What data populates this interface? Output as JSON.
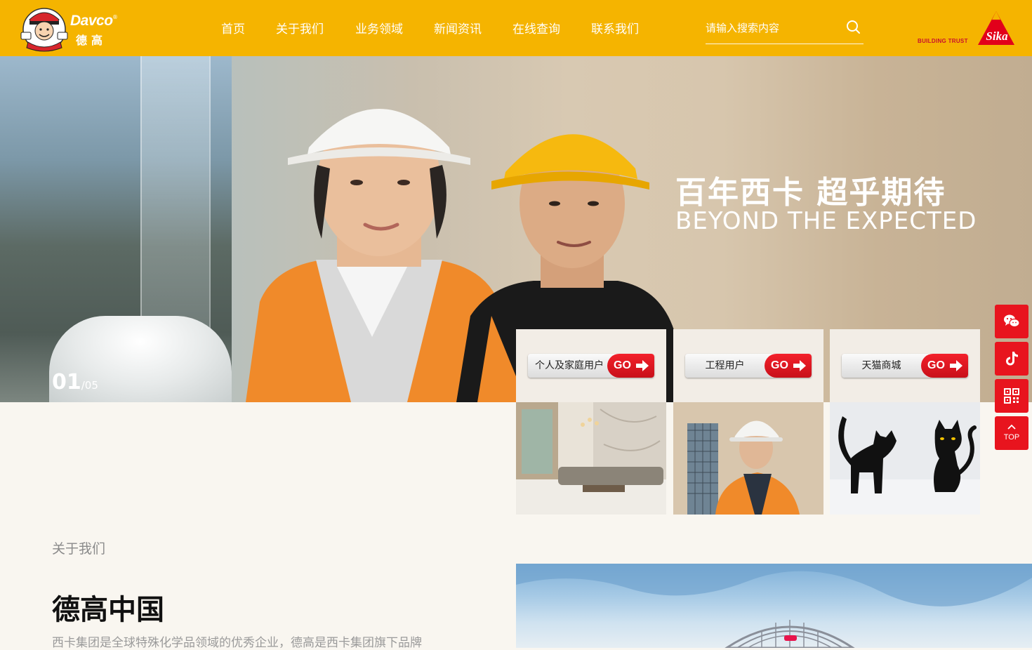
{
  "header": {
    "logo_text": "Davco",
    "logo_sub": "德高",
    "logo_reg": "®",
    "nav": [
      "首页",
      "关于我们",
      "业务领域",
      "新闻资讯",
      "在线查询",
      "联系我们"
    ],
    "search_placeholder": "请输入搜索内容",
    "sika_trust": "BUILDING TRUST",
    "sika_name": "Sika"
  },
  "hero": {
    "title": "百年西卡  超乎期待",
    "subtitle": "BEYOND THE EXPECTED",
    "counter_current": "01",
    "counter_total": "/05"
  },
  "cards": [
    {
      "label": "个人及家庭用户",
      "go": "GO"
    },
    {
      "label": "工程用户",
      "go": "GO"
    },
    {
      "label": "天猫商城",
      "go": "GO"
    }
  ],
  "side": {
    "top_label": "TOP",
    "icons": [
      "wechat-icon",
      "tiktok-icon",
      "qrcode-icon",
      "back-to-top-icon"
    ]
  },
  "about": {
    "label": "关于我们",
    "title": "德高中国",
    "desc": "西卡集团是全球特殊化学品领域的优秀企业，德高是西卡集团旗下品牌"
  },
  "colors": {
    "header_bg": "#f5b400",
    "accent_red": "#e8141e",
    "page_bg": "#f9f6f0"
  }
}
